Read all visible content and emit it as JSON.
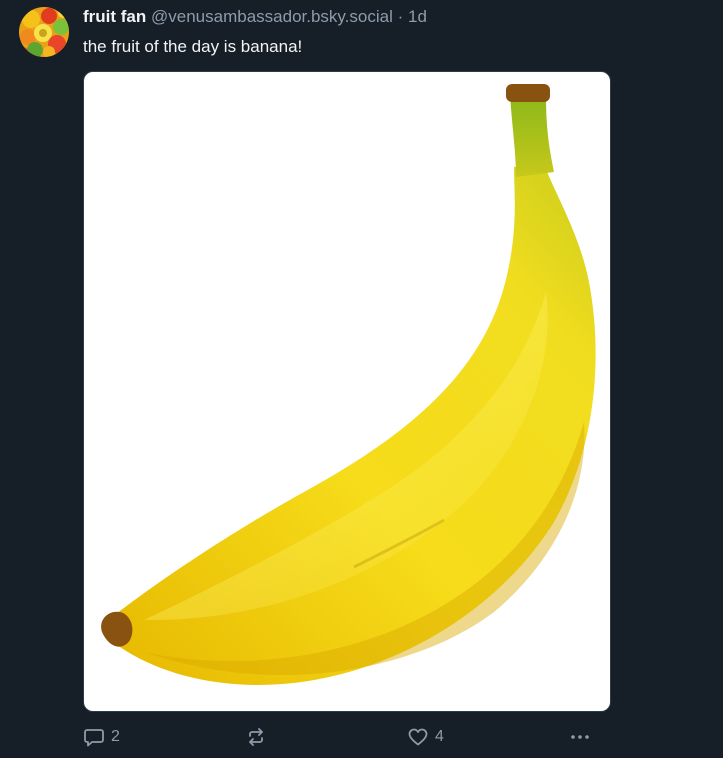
{
  "post": {
    "author": {
      "display_name": "fruit fan",
      "handle": "@venusambassador.bsky.social",
      "separator": "·",
      "timestamp": "1d"
    },
    "text": "the fruit of the day is banana!",
    "avatar_icon": "fruit-avatar",
    "media_icon": "banana-image",
    "actions": {
      "reply_icon": "reply-icon",
      "reply_count": "2",
      "repost_icon": "repost-icon",
      "like_icon": "heart-icon",
      "like_count": "4",
      "more_icon": "more-options-icon"
    }
  },
  "colors": {
    "background": "#161e27",
    "text_primary": "#f1f3f5",
    "text_secondary": "#8d9bab",
    "banana_yellow": "#f2d50f"
  }
}
